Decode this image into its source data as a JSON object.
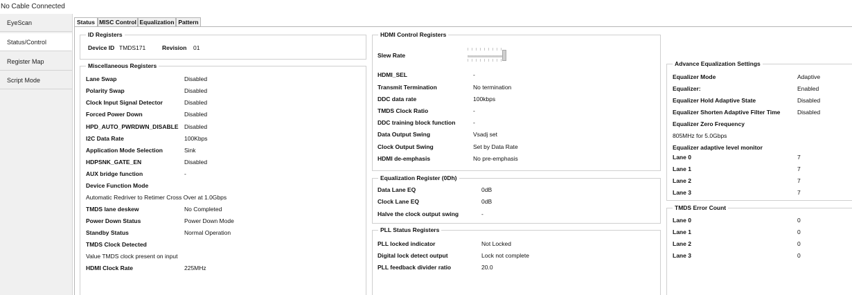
{
  "window": {
    "title": "No Cable Connected"
  },
  "sidebar": {
    "items": [
      {
        "label": "EyeScan"
      },
      {
        "label": "Status/Control"
      },
      {
        "label": "Register Map"
      },
      {
        "label": "Script Mode"
      }
    ]
  },
  "tabs": [
    {
      "label": "Status"
    },
    {
      "label": "MISC Control"
    },
    {
      "label": "Equalization"
    },
    {
      "label": "Pattern"
    }
  ],
  "id_registers": {
    "title": "ID Registers",
    "device_id_label": "Device ID",
    "device_id_value": "TMDS171",
    "revision_label": "Revision",
    "revision_value": "01"
  },
  "misc_registers": {
    "title": "Miscellaneous Registers",
    "rows": [
      {
        "label": "Lane Swap",
        "value": "Disabled"
      },
      {
        "label": "Polarity Swap",
        "value": "Disabled"
      },
      {
        "label": "Clock Input Signal Detector",
        "value": "Disabled"
      },
      {
        "label": "Forced Power Down",
        "value": "Disabled"
      },
      {
        "label": "HPD_AUTO_PWRDWN_DISABLE",
        "value": "Disabled"
      },
      {
        "label": "I2C Data Rate",
        "value": "100Kbps"
      },
      {
        "label": "Application Mode Selection",
        "value": "Sink"
      },
      {
        "label": "HDPSNK_GATE_EN",
        "value": "Disabled"
      },
      {
        "label": "AUX bridge function",
        "value": "-"
      },
      {
        "label": "Device Function Mode",
        "value": ""
      },
      {
        "label": "TMDS lane deskew",
        "value": "No Completed"
      },
      {
        "label": "Power Down Status",
        "value": "Power Down Mode"
      },
      {
        "label": "Standby Status",
        "value": "Normal Operation"
      },
      {
        "label": "TMDS Clock Detected",
        "value": ""
      },
      {
        "label": "HDMI Clock Rate",
        "value": "225MHz"
      }
    ],
    "device_function_text": "Automatic Redriver to Retimer Cross Over at 1.0Gbps",
    "tmds_clock_text": "Value TMDS clock present on input"
  },
  "hdmi_control": {
    "title": "HDMI Control Registers",
    "slew_rate_label": "Slew Rate",
    "slew_rate_level": 1.0,
    "rows": [
      {
        "label": "HDMI_SEL",
        "value": "-"
      },
      {
        "label": "Transmit Termination",
        "value": "No termination"
      },
      {
        "label": "DDC data rate",
        "value": "100kbps"
      },
      {
        "label": "TMDS Clock Ratio",
        "value": "-"
      },
      {
        "label": "DDC training block function",
        "value": "-"
      },
      {
        "label": "Data Output Swing",
        "value": "Vsadj set"
      },
      {
        "label": "Clock Output Swing",
        "value": "Set by Data Rate"
      },
      {
        "label": "HDMI de-emphasis",
        "value": "No pre-emphasis"
      }
    ]
  },
  "eq_register": {
    "title": "Equalization Register (0Dh)",
    "rows": [
      {
        "label": "Data Lane EQ",
        "value": "0dB"
      },
      {
        "label": "Clock Lane EQ",
        "value": "0dB"
      },
      {
        "label": "Halve the clock output swing",
        "value": "-"
      }
    ]
  },
  "pll_status": {
    "title": "PLL Status Registers",
    "rows": [
      {
        "label": "PLL locked indicator",
        "value": "Not Locked"
      },
      {
        "label": "Digital lock detect output",
        "value": "Lock not complete"
      },
      {
        "label": "PLL feedback divider ratio",
        "value": "20.0"
      }
    ]
  },
  "adv_eq": {
    "title": "Advance  Equalization Settings",
    "rows": [
      {
        "label": "Equalizer Mode",
        "value": "Adaptive"
      },
      {
        "label": "Equalizer:",
        "value": "Enabled"
      },
      {
        "label": "Equalizer Hold Adaptive State",
        "value": "Disabled"
      },
      {
        "label": "Equalizer Shorten Adaptive Filter Time",
        "value": "Disabled"
      },
      {
        "label": "Equalizer Zero Frequency",
        "value": ""
      }
    ],
    "zero_freq_text": "805MHz for 5.0Gbps",
    "monitor_label": "Equalizer adaptive level monitor",
    "lanes": [
      {
        "label": "Lane 0",
        "value": "7"
      },
      {
        "label": "Lane 1",
        "value": "7"
      },
      {
        "label": "Lane 2",
        "value": "7"
      },
      {
        "label": "Lane 3",
        "value": "7"
      }
    ]
  },
  "tmds_error": {
    "title": "TMDS Error Count",
    "lanes": [
      {
        "label": "Lane 0",
        "value": "0"
      },
      {
        "label": "Lane 1",
        "value": "0"
      },
      {
        "label": "Lane 2",
        "value": "0"
      },
      {
        "label": "Lane 3",
        "value": "0"
      }
    ]
  }
}
